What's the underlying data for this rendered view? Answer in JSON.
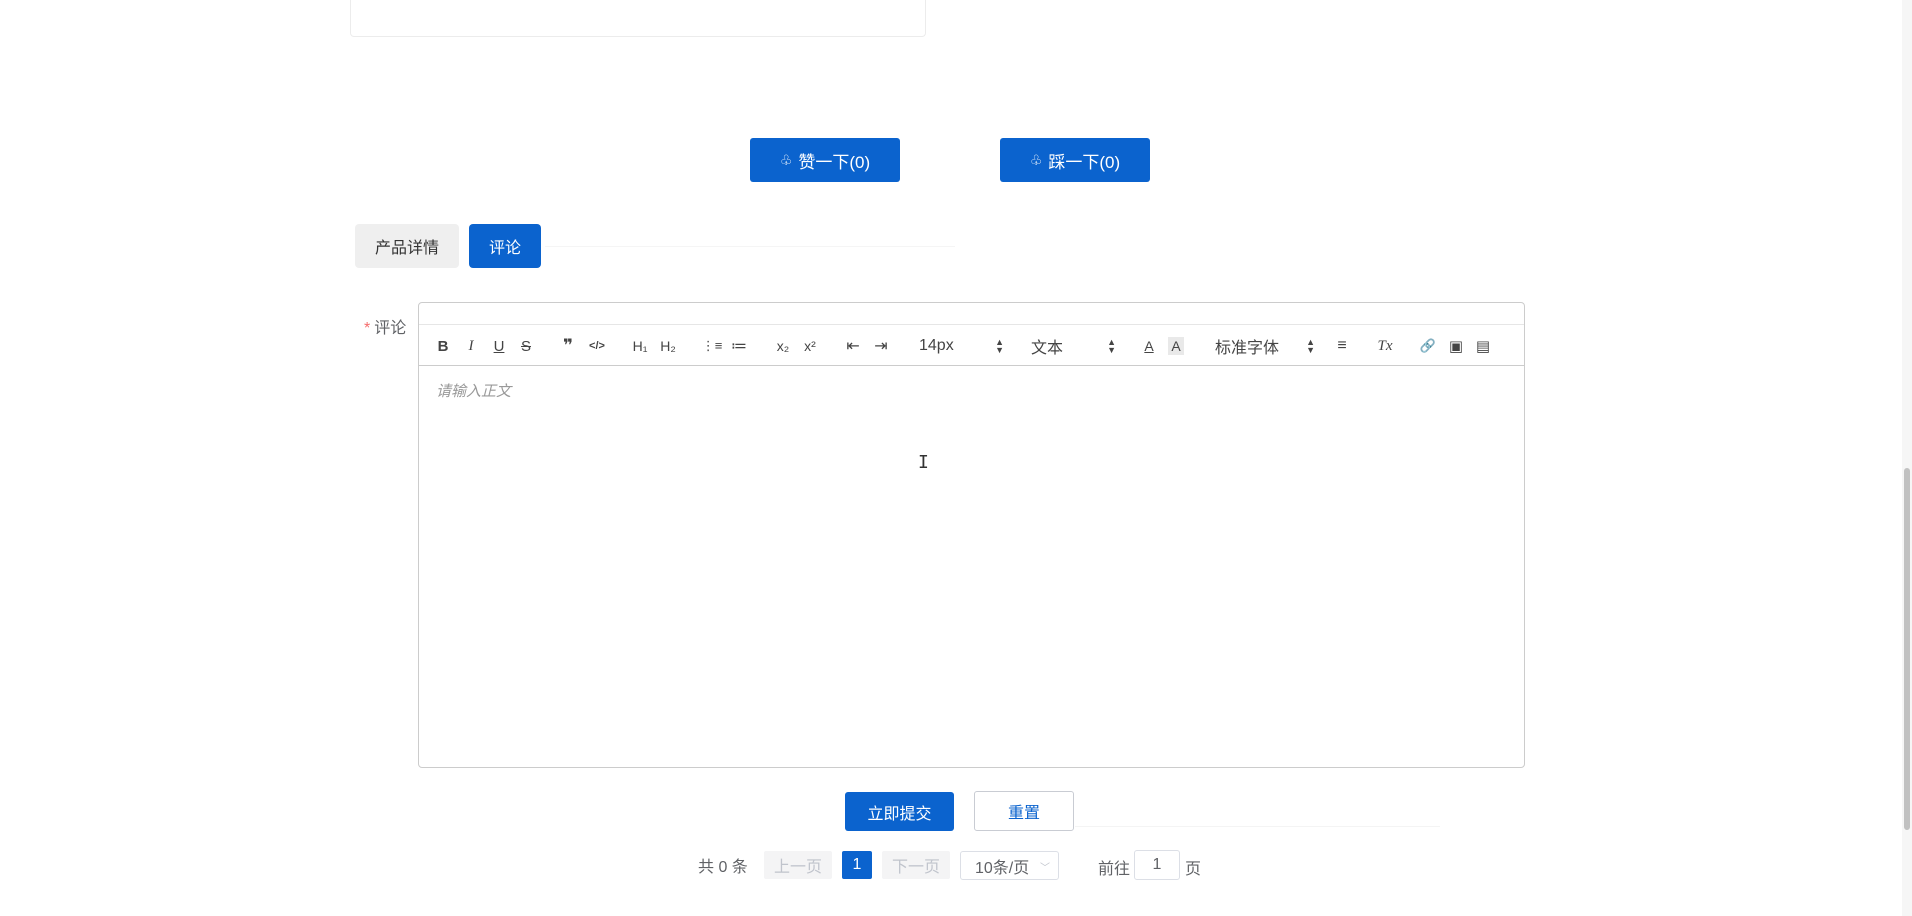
{
  "vote": {
    "like_label": "赞一下(0)",
    "dislike_label": "踩一下(0)",
    "like_icon": "♧",
    "dislike_icon": "♧"
  },
  "tabs": [
    {
      "label": "产品详情",
      "active": false
    },
    {
      "label": "评论",
      "active": true
    }
  ],
  "form": {
    "label": "评论",
    "required_mark": "*",
    "editor": {
      "placeholder": "请输入正文",
      "toolbar": {
        "bold": "B",
        "italic": "I",
        "underline": "U",
        "strike": "S",
        "quote": "❞",
        "code": "</>",
        "h1": "H₁",
        "h2": "H₂",
        "ordered_list": "⋮≡",
        "bullet_list": "≔",
        "subscript": "x₂",
        "superscript": "x²",
        "indent_decrease": "⇤",
        "indent_increase": "⇥",
        "size_value": "14px",
        "header_value": "文本",
        "color": "A",
        "background": "A",
        "font_value": "标准字体",
        "align": "≡",
        "clean": "Tx",
        "link": "🔗",
        "image": "▣",
        "video": "▤"
      }
    },
    "submit_label": "立即提交",
    "reset_label": "重置"
  },
  "pagination": {
    "total_text": "共 0 条",
    "prev_label": "上一页",
    "current_page": "1",
    "next_label": "下一页",
    "page_size": "10条/页",
    "goto_prefix": "前往",
    "goto_value": "1",
    "goto_suffix": "页"
  },
  "colors": {
    "primary": "#0b63ce",
    "required": "#f56c6c",
    "disabled_text": "#c0c4cc"
  }
}
